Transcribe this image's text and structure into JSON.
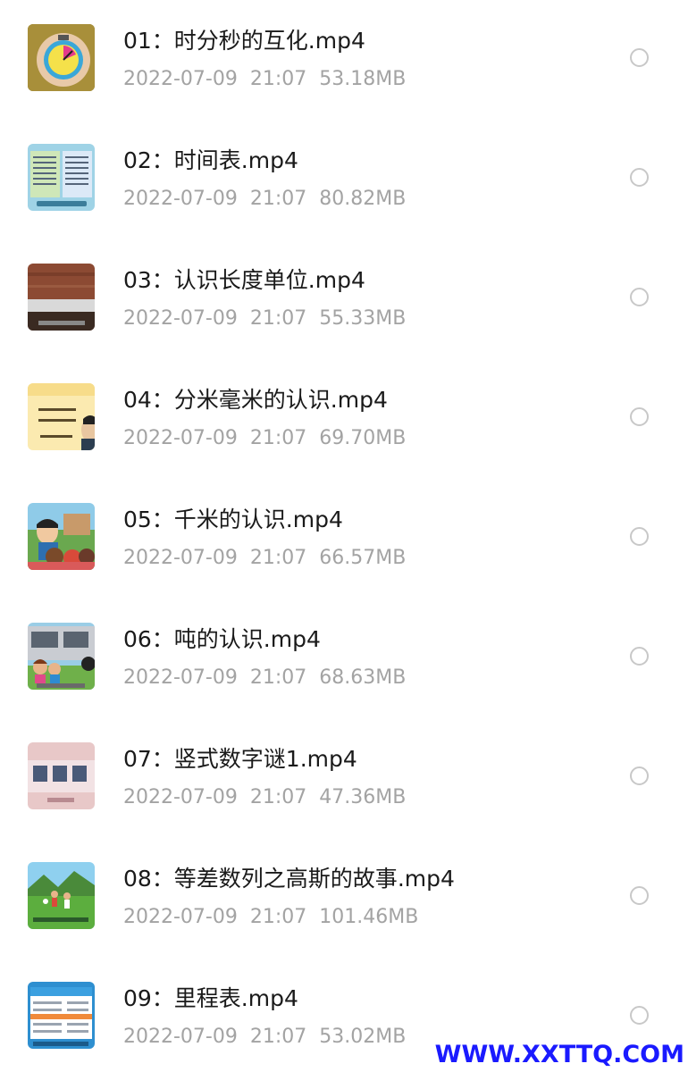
{
  "files": [
    {
      "name": "01：时分秒的互化.mp4",
      "date": "2022-07-09",
      "time": "21:07",
      "size": "53.18MB",
      "thumb": "clock-thumbnail"
    },
    {
      "name": "02：时间表.mp4",
      "date": "2022-07-09",
      "time": "21:07",
      "size": "80.82MB",
      "thumb": "timetable-thumbnail"
    },
    {
      "name": "03：认识长度单位.mp4",
      "date": "2022-07-09",
      "time": "21:07",
      "size": "55.33MB",
      "thumb": "ruler-thumbnail"
    },
    {
      "name": "04：分米毫米的认识.mp4",
      "date": "2022-07-09",
      "time": "21:07",
      "size": "69.70MB",
      "thumb": "blackboard-thumbnail"
    },
    {
      "name": "05：千米的认识.mp4",
      "date": "2022-07-09",
      "time": "21:07",
      "size": "66.57MB",
      "thumb": "classroom-thumbnail"
    },
    {
      "name": "06：吨的认识.mp4",
      "date": "2022-07-09",
      "time": "21:07",
      "size": "68.63MB",
      "thumb": "truck-thumbnail"
    },
    {
      "name": "07：竖式数字谜1.mp4",
      "date": "2022-07-09",
      "time": "21:07",
      "size": "47.36MB",
      "thumb": "puzzle-thumbnail"
    },
    {
      "name": "08：等差数列之高斯的故事.mp4",
      "date": "2022-07-09",
      "time": "21:07",
      "size": "101.46MB",
      "thumb": "field-thumbnail"
    },
    {
      "name": "09：里程表.mp4",
      "date": "2022-07-09",
      "time": "21:07",
      "size": "53.02MB",
      "thumb": "mileage-thumbnail"
    }
  ],
  "watermark": "WWW.XXTTQ.COM"
}
